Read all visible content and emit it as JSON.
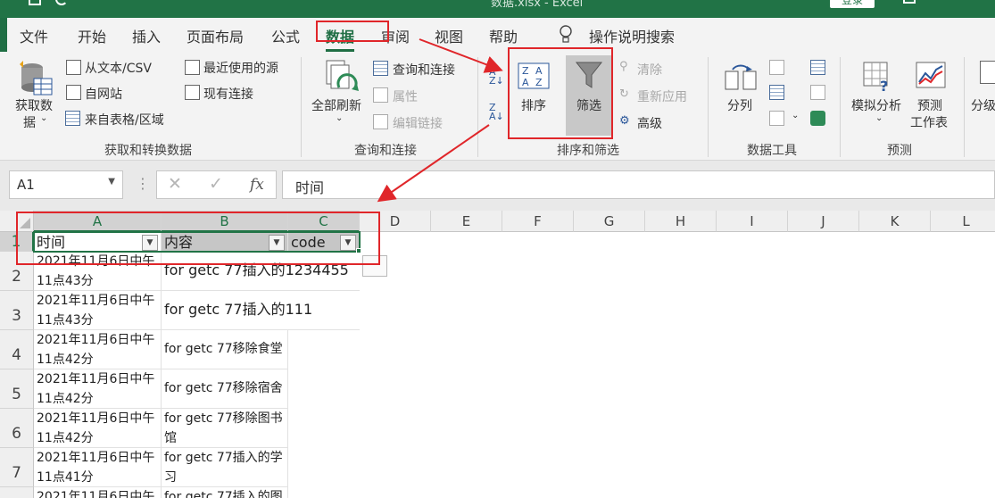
{
  "window": {
    "title": "数据.xlsx  -  Excel",
    "signin": "登录",
    "accent": "#217346",
    "annotation_color": "#e0262a"
  },
  "menu": {
    "tabs": [
      "文件",
      "开始",
      "插入",
      "页面布局",
      "公式",
      "数据",
      "审阅",
      "视图",
      "帮助"
    ],
    "active_tab": "数据",
    "tell_me": "操作说明搜索"
  },
  "ribbon": {
    "get_transform": {
      "get_data": "获取数",
      "get_data2": "据",
      "from_text": "从文本/CSV",
      "from_web": "自网站",
      "from_table": "来自表格/区域",
      "recent_sources": "最近使用的源",
      "existing_connections": "现有连接",
      "label": "获取和转换数据"
    },
    "queries": {
      "refresh_all": "全部刷新",
      "queries_connections": "查询和连接",
      "properties": "属性",
      "edit_links": "编辑链接",
      "label": "查询和连接"
    },
    "sort_filter": {
      "sort": "排序",
      "filter": "筛选",
      "clear": "清除",
      "reapply": "重新应用",
      "advanced": "高级",
      "label": "排序和筛选"
    },
    "data_tools": {
      "text_to_columns": "分列",
      "label": "数据工具"
    },
    "forecast": {
      "what_if": "模拟分析",
      "forecast_sheet": "预测",
      "forecast_sheet2": "工作表",
      "label": "预测"
    },
    "outline": {
      "group": "分级"
    }
  },
  "formula_bar": {
    "name_box": "A1",
    "cancel": "✕",
    "enter": "✓",
    "fx": "fx",
    "content": "时间"
  },
  "sheet": {
    "columns": [
      "A",
      "B",
      "C",
      "D",
      "E",
      "F",
      "G",
      "H",
      "I",
      "J",
      "K",
      "L"
    ],
    "rows": [
      "1",
      "2",
      "3",
      "4",
      "5",
      "6",
      "7"
    ],
    "headers": [
      "时间",
      "内容",
      "code"
    ],
    "data": [
      {
        "a1": "2021年11月6日中午",
        "a2": "11点43分",
        "b": "for getc 77插入的1234455"
      },
      {
        "a1": "2021年11月6日中午",
        "a2": "11点43分",
        "b": "for getc 77插入的111"
      },
      {
        "a1": "2021年11月6日中午",
        "a2": "11点42分",
        "b": "for getc 77移除食堂"
      },
      {
        "a1": "2021年11月6日中午",
        "a2": "11点42分",
        "b": "for getc 77移除宿舍"
      },
      {
        "a1": "2021年11月6日中午",
        "a2": "11点42分",
        "b": "for getc 77移除图书",
        "b2": "馆"
      },
      {
        "a1": "2021年11月6日中午",
        "a2": "11点41分",
        "b": "for getc 77插入的学",
        "b2": "习"
      },
      {
        "a1": "2021年11月6日中午",
        "b": "for getc 77插入的图"
      }
    ]
  }
}
